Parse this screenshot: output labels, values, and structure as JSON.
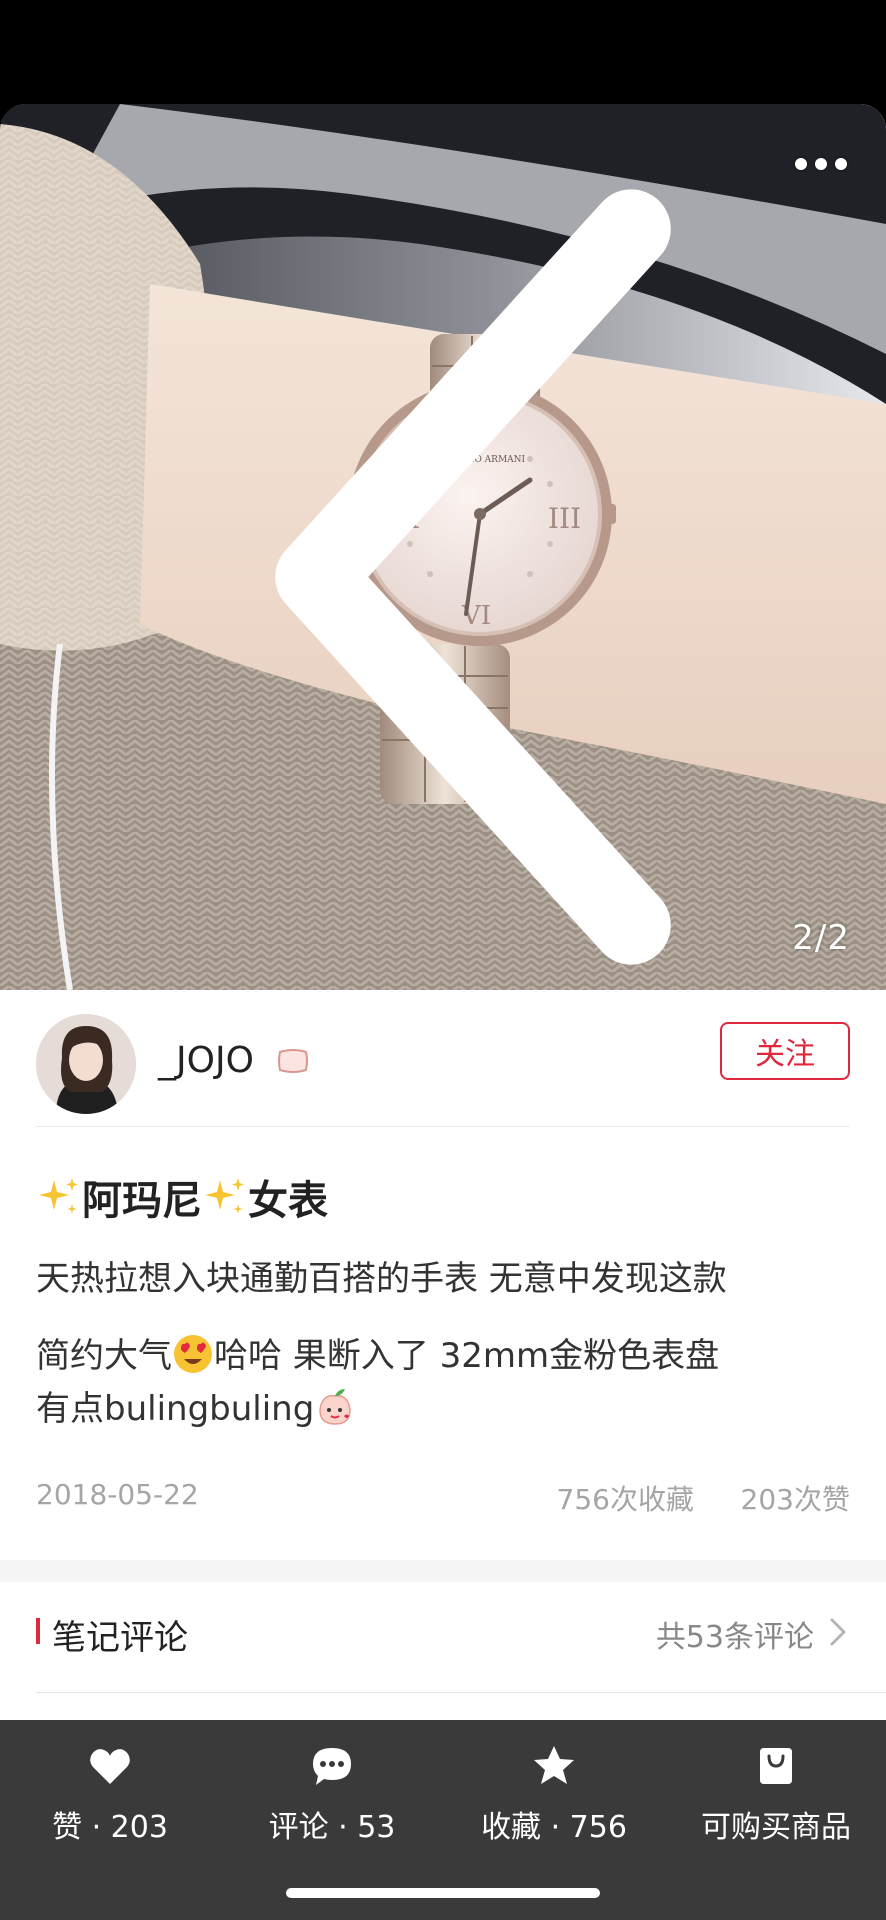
{
  "photo": {
    "page_counter": "2/2",
    "watch_brand_text": "EMPORIO ARMANI"
  },
  "toolbar": {
    "back_icon": "chevron-left-icon",
    "more_icon": "more-dots-icon"
  },
  "author": {
    "name": "_JOJO",
    "follow_label": "关注"
  },
  "note": {
    "title_part1": "阿玛尼",
    "title_part2": "女表",
    "body_line1": "天热拉想入块通勤百搭的手表  无意中发现这款",
    "body_line2a": "简约大气",
    "body_line2b": "哈哈  果断入了  32mm金粉色表盘",
    "body_line3a": "有点bulingbuling",
    "date": "2018-05-22",
    "favorites": "756次收藏",
    "likes": "203次赞"
  },
  "comments": {
    "title": "笔记评论",
    "count_label": "共53条评论"
  },
  "bottom_bar": {
    "like_label": "赞 · 203",
    "comment_label": "评论 · 53",
    "favorite_label": "收藏 · 756",
    "shop_label": "可购买商品"
  },
  "colors": {
    "accent_red": "#e0283d",
    "bottom_bar_bg": "#3a3a3a"
  }
}
